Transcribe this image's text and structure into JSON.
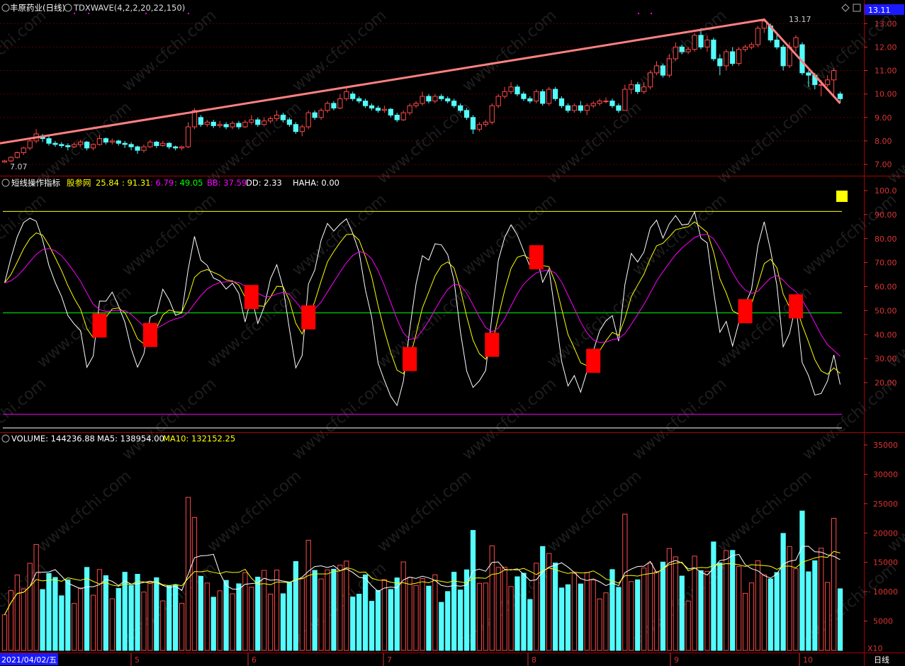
{
  "colors": {
    "up": "#ff4a4a",
    "down": "#54fcfc",
    "grid": "#7a0000",
    "axis": "#d33333",
    "white": "#ffffff",
    "yellow": "#ffff00",
    "magenta": "#ff00ff",
    "green": "#00ff00",
    "trend": "#ff8080"
  },
  "header": {
    "stock": "丰原药业(日线)",
    "indicator": "TDXWAVE(4,2,2,20,22,150)",
    "price_badge": "13.11",
    "symbol_icon": "diamond-icon",
    "setting_icon": "square-icon"
  },
  "price_panel": {
    "high_label": "13.17",
    "low_label": "7.07",
    "ylim": [
      6.7,
      13.4
    ],
    "ticks": [
      "13.00",
      "12.00",
      "11.00",
      "10.00",
      "9.00",
      "8.00",
      "7.00"
    ]
  },
  "osc_panel": {
    "title": "短线操作指标",
    "series_label": "股参网",
    "v1": "25.84",
    "v2": ": 91.31",
    "v3": ": 6.79",
    "v4": ": 49.05",
    "bb": "BB: 37.59",
    "dd": "DD: 2.33",
    "haha": "HAHA: 0.00",
    "ticks": [
      "100.0",
      "90.00",
      "80.00",
      "70.00",
      "60.00",
      "50.00",
      "40.00",
      "30.00",
      "20.00"
    ]
  },
  "vol_panel": {
    "volume": "VOLUME: 144236.88",
    "ma5": "MA5: 138954.00",
    "ma10": "MA10: 132152.25",
    "ticks": [
      "35000",
      "30000",
      "25000",
      "20000",
      "15000",
      "10000",
      "5000"
    ],
    "unit": "X10"
  },
  "xaxis": {
    "date_badge": "2021/04/02/五",
    "months": [
      "5",
      "6",
      "7",
      "8",
      "9",
      "10"
    ],
    "period": "日线"
  },
  "watermark": "www.cfchi.com",
  "chart_data": {
    "type": "candlestick",
    "title": "丰原药业(日线)",
    "price_range": [
      7.07,
      13.17
    ],
    "lines": {
      "overbought": 91.31,
      "mid": 49.05,
      "oversold": 6.79
    },
    "signal_bars_count": 11,
    "candles": [
      {
        "o": 7.1,
        "c": 7.15,
        "h": 7.2,
        "l": 7.07
      },
      {
        "o": 7.15,
        "c": 7.3,
        "h": 7.35,
        "l": 7.1
      },
      {
        "o": 7.3,
        "c": 7.5,
        "h": 7.55,
        "l": 7.25
      },
      {
        "o": 7.5,
        "c": 7.7,
        "h": 7.75,
        "l": 7.4
      },
      {
        "o": 7.7,
        "c": 8.0,
        "h": 8.1,
        "l": 7.6
      },
      {
        "o": 8.0,
        "c": 8.3,
        "h": 8.5,
        "l": 7.9
      },
      {
        "o": 8.2,
        "c": 8.1,
        "h": 8.3,
        "l": 7.95
      },
      {
        "o": 8.1,
        "c": 7.9,
        "h": 8.2,
        "l": 7.8
      },
      {
        "o": 7.9,
        "c": 7.85,
        "h": 8.0,
        "l": 7.75
      },
      {
        "o": 7.85,
        "c": 7.8,
        "h": 7.95,
        "l": 7.7
      },
      {
        "o": 7.8,
        "c": 7.75,
        "h": 7.9,
        "l": 7.6
      },
      {
        "o": 7.75,
        "c": 7.85,
        "h": 7.95,
        "l": 7.7
      },
      {
        "o": 7.85,
        "c": 7.95,
        "h": 8.05,
        "l": 7.75
      },
      {
        "o": 7.95,
        "c": 7.7,
        "h": 8.0,
        "l": 7.6
      },
      {
        "o": 7.7,
        "c": 7.85,
        "h": 7.9,
        "l": 7.6
      },
      {
        "o": 7.85,
        "c": 8.1,
        "h": 8.25,
        "l": 7.8
      },
      {
        "o": 8.1,
        "c": 7.95,
        "h": 8.15,
        "l": 7.85
      },
      {
        "o": 7.95,
        "c": 8.0,
        "h": 8.1,
        "l": 7.85
      },
      {
        "o": 8.0,
        "c": 7.9,
        "h": 8.05,
        "l": 7.8
      },
      {
        "o": 7.9,
        "c": 7.85,
        "h": 8.0,
        "l": 7.7
      },
      {
        "o": 7.85,
        "c": 7.75,
        "h": 7.95,
        "l": 7.6
      },
      {
        "o": 7.75,
        "c": 7.6,
        "h": 7.8,
        "l": 7.45
      },
      {
        "o": 7.6,
        "c": 7.75,
        "h": 7.85,
        "l": 7.5
      },
      {
        "o": 7.75,
        "c": 7.95,
        "h": 8.05,
        "l": 7.7
      },
      {
        "o": 7.95,
        "c": 7.8,
        "h": 8.0,
        "l": 7.7
      },
      {
        "o": 7.8,
        "c": 7.9,
        "h": 8.0,
        "l": 7.75
      },
      {
        "o": 7.9,
        "c": 7.75,
        "h": 7.95,
        "l": 7.65
      },
      {
        "o": 7.75,
        "c": 7.7,
        "h": 7.8,
        "l": 7.6
      },
      {
        "o": 7.7,
        "c": 7.75,
        "h": 7.8,
        "l": 7.6
      },
      {
        "o": 7.75,
        "c": 8.6,
        "h": 8.8,
        "l": 7.7
      },
      {
        "o": 8.6,
        "c": 9.3,
        "h": 9.4,
        "l": 8.5
      },
      {
        "o": 9.0,
        "c": 8.7,
        "h": 9.1,
        "l": 8.6
      },
      {
        "o": 8.7,
        "c": 8.8,
        "h": 8.9,
        "l": 8.6
      },
      {
        "o": 8.8,
        "c": 8.65,
        "h": 8.9,
        "l": 8.55
      },
      {
        "o": 8.65,
        "c": 8.7,
        "h": 8.85,
        "l": 8.55
      },
      {
        "o": 8.7,
        "c": 8.6,
        "h": 8.8,
        "l": 8.5
      },
      {
        "o": 8.6,
        "c": 8.75,
        "h": 8.85,
        "l": 8.5
      },
      {
        "o": 8.75,
        "c": 8.6,
        "h": 8.85,
        "l": 8.5
      },
      {
        "o": 8.6,
        "c": 8.8,
        "h": 8.9,
        "l": 8.55
      },
      {
        "o": 8.8,
        "c": 8.9,
        "h": 9.1,
        "l": 8.7
      },
      {
        "o": 8.9,
        "c": 8.7,
        "h": 9.0,
        "l": 8.6
      },
      {
        "o": 8.7,
        "c": 8.85,
        "h": 9.0,
        "l": 8.65
      },
      {
        "o": 8.85,
        "c": 8.95,
        "h": 9.05,
        "l": 8.75
      },
      {
        "o": 8.95,
        "c": 9.1,
        "h": 9.3,
        "l": 8.85
      },
      {
        "o": 9.1,
        "c": 8.9,
        "h": 9.2,
        "l": 8.8
      },
      {
        "o": 8.9,
        "c": 8.7,
        "h": 9.0,
        "l": 8.6
      },
      {
        "o": 8.7,
        "c": 8.4,
        "h": 8.8,
        "l": 8.3
      },
      {
        "o": 8.4,
        "c": 8.6,
        "h": 8.7,
        "l": 8.2
      },
      {
        "o": 8.6,
        "c": 9.2,
        "h": 9.3,
        "l": 8.5
      },
      {
        "o": 9.2,
        "c": 9.0,
        "h": 9.3,
        "l": 8.9
      },
      {
        "o": 9.0,
        "c": 9.3,
        "h": 9.4,
        "l": 8.9
      },
      {
        "o": 9.3,
        "c": 9.6,
        "h": 9.7,
        "l": 9.2
      },
      {
        "o": 9.6,
        "c": 9.4,
        "h": 9.7,
        "l": 9.3
      },
      {
        "o": 9.4,
        "c": 9.8,
        "h": 10.0,
        "l": 9.35
      },
      {
        "o": 9.8,
        "c": 10.1,
        "h": 10.3,
        "l": 9.7
      },
      {
        "o": 10.0,
        "c": 9.8,
        "h": 10.1,
        "l": 9.7
      },
      {
        "o": 9.8,
        "c": 9.7,
        "h": 9.9,
        "l": 9.6
      },
      {
        "o": 9.7,
        "c": 9.5,
        "h": 9.8,
        "l": 9.4
      },
      {
        "o": 9.5,
        "c": 9.4,
        "h": 9.6,
        "l": 9.3
      },
      {
        "o": 9.4,
        "c": 9.3,
        "h": 9.5,
        "l": 9.2
      },
      {
        "o": 9.3,
        "c": 9.35,
        "h": 9.5,
        "l": 9.2
      },
      {
        "o": 9.35,
        "c": 9.1,
        "h": 9.4,
        "l": 9.0
      },
      {
        "o": 9.1,
        "c": 8.9,
        "h": 9.2,
        "l": 8.8
      },
      {
        "o": 8.9,
        "c": 9.2,
        "h": 9.3,
        "l": 8.85
      },
      {
        "o": 9.2,
        "c": 9.5,
        "h": 9.6,
        "l": 9.1
      },
      {
        "o": 9.5,
        "c": 9.6,
        "h": 9.7,
        "l": 9.4
      },
      {
        "o": 9.6,
        "c": 9.9,
        "h": 10.1,
        "l": 9.5
      },
      {
        "o": 9.9,
        "c": 9.7,
        "h": 10.0,
        "l": 9.6
      },
      {
        "o": 9.7,
        "c": 9.9,
        "h": 10.0,
        "l": 9.6
      },
      {
        "o": 9.9,
        "c": 9.8,
        "h": 10.0,
        "l": 9.7
      },
      {
        "o": 9.8,
        "c": 9.7,
        "h": 9.9,
        "l": 9.6
      },
      {
        "o": 9.7,
        "c": 9.5,
        "h": 9.8,
        "l": 9.4
      },
      {
        "o": 9.5,
        "c": 9.3,
        "h": 9.6,
        "l": 9.2
      },
      {
        "o": 9.3,
        "c": 9.0,
        "h": 9.4,
        "l": 8.9
      },
      {
        "o": 9.0,
        "c": 8.5,
        "h": 9.1,
        "l": 8.3
      },
      {
        "o": 8.5,
        "c": 8.7,
        "h": 8.8,
        "l": 8.4
      },
      {
        "o": 8.7,
        "c": 8.8,
        "h": 8.9,
        "l": 8.6
      },
      {
        "o": 8.8,
        "c": 9.5,
        "h": 9.6,
        "l": 8.7
      },
      {
        "o": 9.5,
        "c": 9.9,
        "h": 10.0,
        "l": 9.4
      },
      {
        "o": 9.9,
        "c": 10.1,
        "h": 10.3,
        "l": 9.8
      },
      {
        "o": 10.1,
        "c": 10.3,
        "h": 10.5,
        "l": 10.0
      },
      {
        "o": 10.3,
        "c": 10.0,
        "h": 10.4,
        "l": 9.9
      },
      {
        "o": 10.0,
        "c": 9.8,
        "h": 10.1,
        "l": 9.7
      },
      {
        "o": 9.8,
        "c": 9.7,
        "h": 9.9,
        "l": 9.6
      },
      {
        "o": 9.7,
        "c": 10.1,
        "h": 10.2,
        "l": 9.6
      },
      {
        "o": 10.1,
        "c": 9.6,
        "h": 10.2,
        "l": 9.5
      },
      {
        "o": 9.6,
        "c": 10.2,
        "h": 10.3,
        "l": 9.5
      },
      {
        "o": 10.2,
        "c": 9.8,
        "h": 10.3,
        "l": 9.7
      },
      {
        "o": 9.8,
        "c": 9.5,
        "h": 9.9,
        "l": 9.4
      },
      {
        "o": 9.5,
        "c": 9.3,
        "h": 9.6,
        "l": 9.2
      },
      {
        "o": 9.3,
        "c": 9.5,
        "h": 9.6,
        "l": 9.2
      },
      {
        "o": 9.5,
        "c": 9.3,
        "h": 9.7,
        "l": 9.2
      },
      {
        "o": 9.3,
        "c": 9.5,
        "h": 9.6,
        "l": 9.1
      },
      {
        "o": 9.5,
        "c": 9.6,
        "h": 9.7,
        "l": 9.4
      },
      {
        "o": 9.6,
        "c": 9.7,
        "h": 9.8,
        "l": 9.5
      },
      {
        "o": 9.7,
        "c": 9.7,
        "h": 9.85,
        "l": 9.6
      },
      {
        "o": 9.7,
        "c": 9.5,
        "h": 9.8,
        "l": 9.4
      },
      {
        "o": 9.5,
        "c": 9.3,
        "h": 9.6,
        "l": 9.2
      },
      {
        "o": 9.3,
        "c": 10.2,
        "h": 10.4,
        "l": 9.3
      },
      {
        "o": 10.2,
        "c": 10.4,
        "h": 10.6,
        "l": 10.0
      },
      {
        "o": 10.4,
        "c": 10.1,
        "h": 10.5,
        "l": 10.0
      },
      {
        "o": 10.1,
        "c": 10.3,
        "h": 10.5,
        "l": 10.0
      },
      {
        "o": 10.3,
        "c": 10.9,
        "h": 11.0,
        "l": 10.2
      },
      {
        "o": 10.9,
        "c": 11.2,
        "h": 11.4,
        "l": 10.8
      },
      {
        "o": 11.2,
        "c": 10.8,
        "h": 11.3,
        "l": 10.7
      },
      {
        "o": 10.8,
        "c": 11.5,
        "h": 11.7,
        "l": 10.7
      },
      {
        "o": 11.5,
        "c": 12.0,
        "h": 12.2,
        "l": 11.4
      },
      {
        "o": 12.0,
        "c": 11.8,
        "h": 12.1,
        "l": 11.7
      },
      {
        "o": 11.8,
        "c": 11.9,
        "h": 12.0,
        "l": 11.7
      },
      {
        "o": 11.9,
        "c": 12.5,
        "h": 12.6,
        "l": 11.8
      },
      {
        "o": 12.5,
        "c": 12.0,
        "h": 12.8,
        "l": 11.9
      },
      {
        "o": 12.0,
        "c": 12.3,
        "h": 12.5,
        "l": 11.8
      },
      {
        "o": 12.3,
        "c": 11.5,
        "h": 12.4,
        "l": 11.4
      },
      {
        "o": 11.5,
        "c": 11.2,
        "h": 11.7,
        "l": 10.8
      },
      {
        "o": 11.2,
        "c": 11.8,
        "h": 11.9,
        "l": 11.0
      },
      {
        "o": 11.8,
        "c": 11.3,
        "h": 12.0,
        "l": 11.2
      },
      {
        "o": 11.3,
        "c": 11.9,
        "h": 12.0,
        "l": 11.2
      },
      {
        "o": 11.9,
        "c": 12.0,
        "h": 12.1,
        "l": 11.8
      },
      {
        "o": 12.0,
        "c": 12.1,
        "h": 12.2,
        "l": 11.9
      },
      {
        "o": 12.1,
        "c": 12.8,
        "h": 12.9,
        "l": 12.0
      },
      {
        "o": 12.8,
        "c": 13.1,
        "h": 13.17,
        "l": 12.6
      },
      {
        "o": 12.9,
        "c": 12.3,
        "h": 13.0,
        "l": 12.2
      },
      {
        "o": 12.3,
        "c": 12.0,
        "h": 12.6,
        "l": 11.9
      },
      {
        "o": 12.0,
        "c": 11.2,
        "h": 12.1,
        "l": 11.0
      },
      {
        "o": 11.2,
        "c": 12.0,
        "h": 12.2,
        "l": 11.1
      },
      {
        "o": 12.0,
        "c": 12.4,
        "h": 12.5,
        "l": 11.8
      },
      {
        "o": 12.1,
        "c": 10.9,
        "h": 12.2,
        "l": 10.8
      },
      {
        "o": 10.9,
        "c": 10.8,
        "h": 11.0,
        "l": 10.3
      },
      {
        "o": 10.8,
        "c": 10.4,
        "h": 10.9,
        "l": 10.2
      },
      {
        "o": 10.4,
        "c": 10.4,
        "h": 10.6,
        "l": 9.9
      },
      {
        "o": 10.4,
        "c": 10.6,
        "h": 10.8,
        "l": 10.3
      },
      {
        "o": 10.6,
        "c": 11.0,
        "h": 11.1,
        "l": 9.9
      },
      {
        "o": 10.0,
        "c": 9.8,
        "h": 10.1,
        "l": 9.6
      }
    ]
  }
}
